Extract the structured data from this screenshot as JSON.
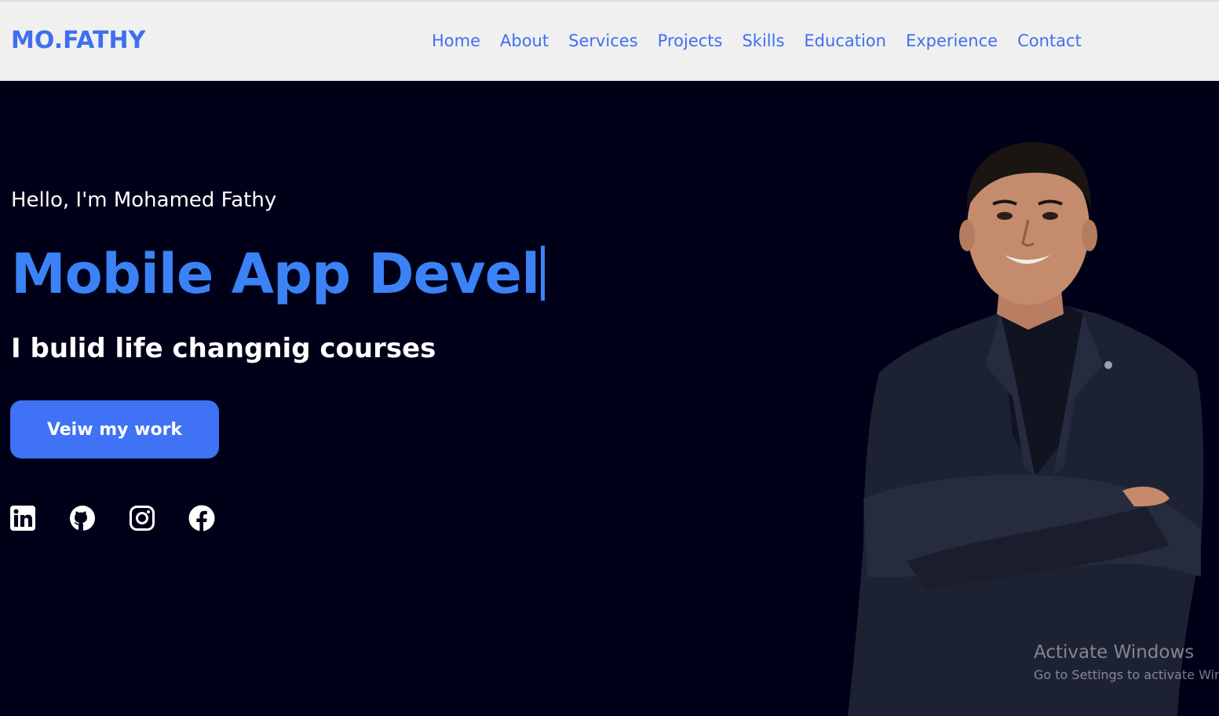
{
  "header": {
    "logo": "MO.FATHY",
    "nav": [
      "Home",
      "About",
      "Services",
      "Projects",
      "Skills",
      "Education",
      "Experience",
      "Contact"
    ]
  },
  "hero": {
    "greeting": "Hello, I'm Mohamed Fathy",
    "role_typed": "Mobile App Devel",
    "tagline": "I bulid life changnig courses",
    "cta_label": "Veiw my work",
    "socials": [
      "linkedin-icon",
      "github-icon",
      "instagram-icon",
      "facebook-icon"
    ]
  },
  "watermark": {
    "title": "Activate Windows",
    "subtitle": "Go to Settings to activate Windows."
  },
  "colors": {
    "accent": "#3f6ff0",
    "background": "#000018",
    "navbar": "#f0f0f0",
    "button": "#3f72f4"
  }
}
